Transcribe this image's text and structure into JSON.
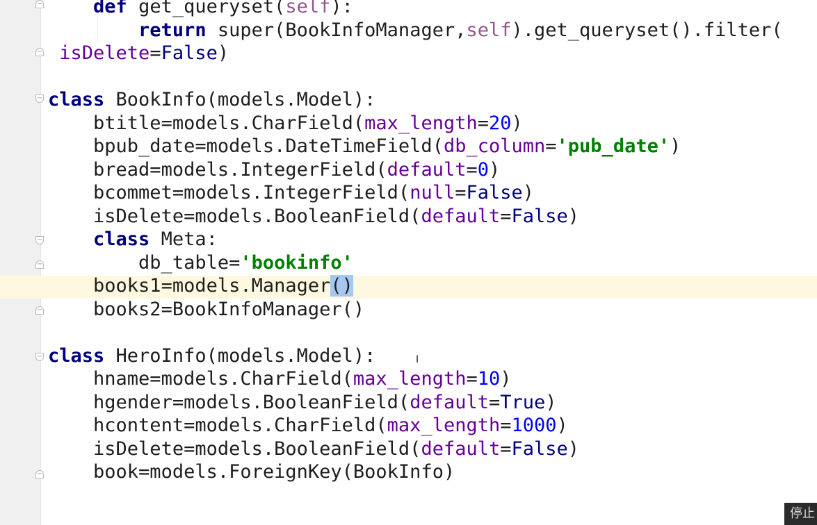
{
  "editor": {
    "language": "python",
    "lines": [
      {
        "indent": "    ",
        "tokens": [
          {
            "t": "def",
            "c": "kw"
          },
          {
            "t": " get_queryset(",
            "c": ""
          },
          {
            "t": "self",
            "c": "self"
          },
          {
            "t": "):",
            "c": ""
          }
        ]
      },
      {
        "indent": "        ",
        "tokens": [
          {
            "t": "return",
            "c": "kw"
          },
          {
            "t": " super(BookInfoManager,",
            "c": ""
          },
          {
            "t": "self",
            "c": "self"
          },
          {
            "t": ").get_queryset().filter(",
            "c": ""
          }
        ]
      },
      {
        "indent": " ",
        "tokens": [
          {
            "t": "isDelete",
            "c": "param"
          },
          {
            "t": "=",
            "c": ""
          },
          {
            "t": "False",
            "c": "const"
          },
          {
            "t": ")",
            "c": ""
          }
        ]
      },
      {
        "indent": "",
        "tokens": []
      },
      {
        "indent": "",
        "tokens": [
          {
            "t": "class",
            "c": "kw"
          },
          {
            "t": " BookInfo(models.Model):",
            "c": ""
          }
        ]
      },
      {
        "indent": "    ",
        "tokens": [
          {
            "t": "btitle=models.CharField(",
            "c": ""
          },
          {
            "t": "max_length",
            "c": "param"
          },
          {
            "t": "=",
            "c": ""
          },
          {
            "t": "20",
            "c": "num"
          },
          {
            "t": ")",
            "c": ""
          }
        ]
      },
      {
        "indent": "    ",
        "tokens": [
          {
            "t": "bpub_date=models.DateTimeField(",
            "c": ""
          },
          {
            "t": "db_column",
            "c": "param"
          },
          {
            "t": "=",
            "c": ""
          },
          {
            "t": "'pub_date'",
            "c": "str"
          },
          {
            "t": ")",
            "c": ""
          }
        ]
      },
      {
        "indent": "    ",
        "tokens": [
          {
            "t": "bread=models.IntegerField(",
            "c": ""
          },
          {
            "t": "default",
            "c": "param"
          },
          {
            "t": "=",
            "c": ""
          },
          {
            "t": "0",
            "c": "num"
          },
          {
            "t": ")",
            "c": ""
          }
        ]
      },
      {
        "indent": "    ",
        "tokens": [
          {
            "t": "bcommet=models.IntegerField(",
            "c": ""
          },
          {
            "t": "null",
            "c": "param"
          },
          {
            "t": "=",
            "c": ""
          },
          {
            "t": "False",
            "c": "const"
          },
          {
            "t": ")",
            "c": ""
          }
        ]
      },
      {
        "indent": "    ",
        "tokens": [
          {
            "t": "isDelete=models.BooleanField(",
            "c": ""
          },
          {
            "t": "default",
            "c": "param"
          },
          {
            "t": "=",
            "c": ""
          },
          {
            "t": "False",
            "c": "const"
          },
          {
            "t": ")",
            "c": ""
          }
        ]
      },
      {
        "indent": "    ",
        "tokens": [
          {
            "t": "class",
            "c": "kw"
          },
          {
            "t": " Meta:",
            "c": ""
          }
        ]
      },
      {
        "indent": "        ",
        "tokens": [
          {
            "t": "db_table=",
            "c": ""
          },
          {
            "t": "'bookinfo'",
            "c": "str"
          }
        ]
      },
      {
        "indent": "    ",
        "tokens": [
          {
            "t": "books1=models.Manager",
            "c": ""
          },
          {
            "t": "()",
            "c": "brace-match"
          }
        ]
      },
      {
        "indent": "    ",
        "tokens": [
          {
            "t": "books2=BookInfoManager()",
            "c": ""
          }
        ]
      },
      {
        "indent": "",
        "tokens": []
      },
      {
        "indent": "",
        "tokens": [
          {
            "t": "class",
            "c": "kw"
          },
          {
            "t": " HeroInfo(models.Model):",
            "c": ""
          }
        ]
      },
      {
        "indent": "    ",
        "tokens": [
          {
            "t": "hname=models.CharField(",
            "c": ""
          },
          {
            "t": "max_length",
            "c": "param"
          },
          {
            "t": "=",
            "c": ""
          },
          {
            "t": "10",
            "c": "num"
          },
          {
            "t": ")",
            "c": ""
          }
        ]
      },
      {
        "indent": "    ",
        "tokens": [
          {
            "t": "hgender=models.BooleanField(",
            "c": ""
          },
          {
            "t": "default",
            "c": "param"
          },
          {
            "t": "=",
            "c": ""
          },
          {
            "t": "True",
            "c": "const"
          },
          {
            "t": ")",
            "c": ""
          }
        ]
      },
      {
        "indent": "    ",
        "tokens": [
          {
            "t": "hcontent=models.CharField(",
            "c": ""
          },
          {
            "t": "max_length",
            "c": "param"
          },
          {
            "t": "=",
            "c": ""
          },
          {
            "t": "1000",
            "c": "num"
          },
          {
            "t": ")",
            "c": ""
          }
        ]
      },
      {
        "indent": "    ",
        "tokens": [
          {
            "t": "isDelete=models.BooleanField(",
            "c": ""
          },
          {
            "t": "default",
            "c": "param"
          },
          {
            "t": "=",
            "c": ""
          },
          {
            "t": "False",
            "c": "const"
          },
          {
            "t": ")",
            "c": ""
          }
        ]
      },
      {
        "indent": "    ",
        "tokens": [
          {
            "t": "book=models.ForeignKey(BookInfo)",
            "c": ""
          }
        ]
      }
    ],
    "current_line_index": 12
  },
  "overlay": {
    "badge_text": "停止"
  },
  "colors": {
    "keyword": "#00007f",
    "self": "#94558d",
    "named_param": "#660099",
    "number": "#0000ff",
    "string": "#008000",
    "constant": "#000080",
    "caret_row": "#fdf8df",
    "brace_match": "#a4c8ef",
    "gutter": "#f0f0f0"
  },
  "icons": {
    "fold_open": "fold-open-icon",
    "fold_close": "fold-close-icon",
    "mouse_cursor": "text-cursor-icon"
  }
}
